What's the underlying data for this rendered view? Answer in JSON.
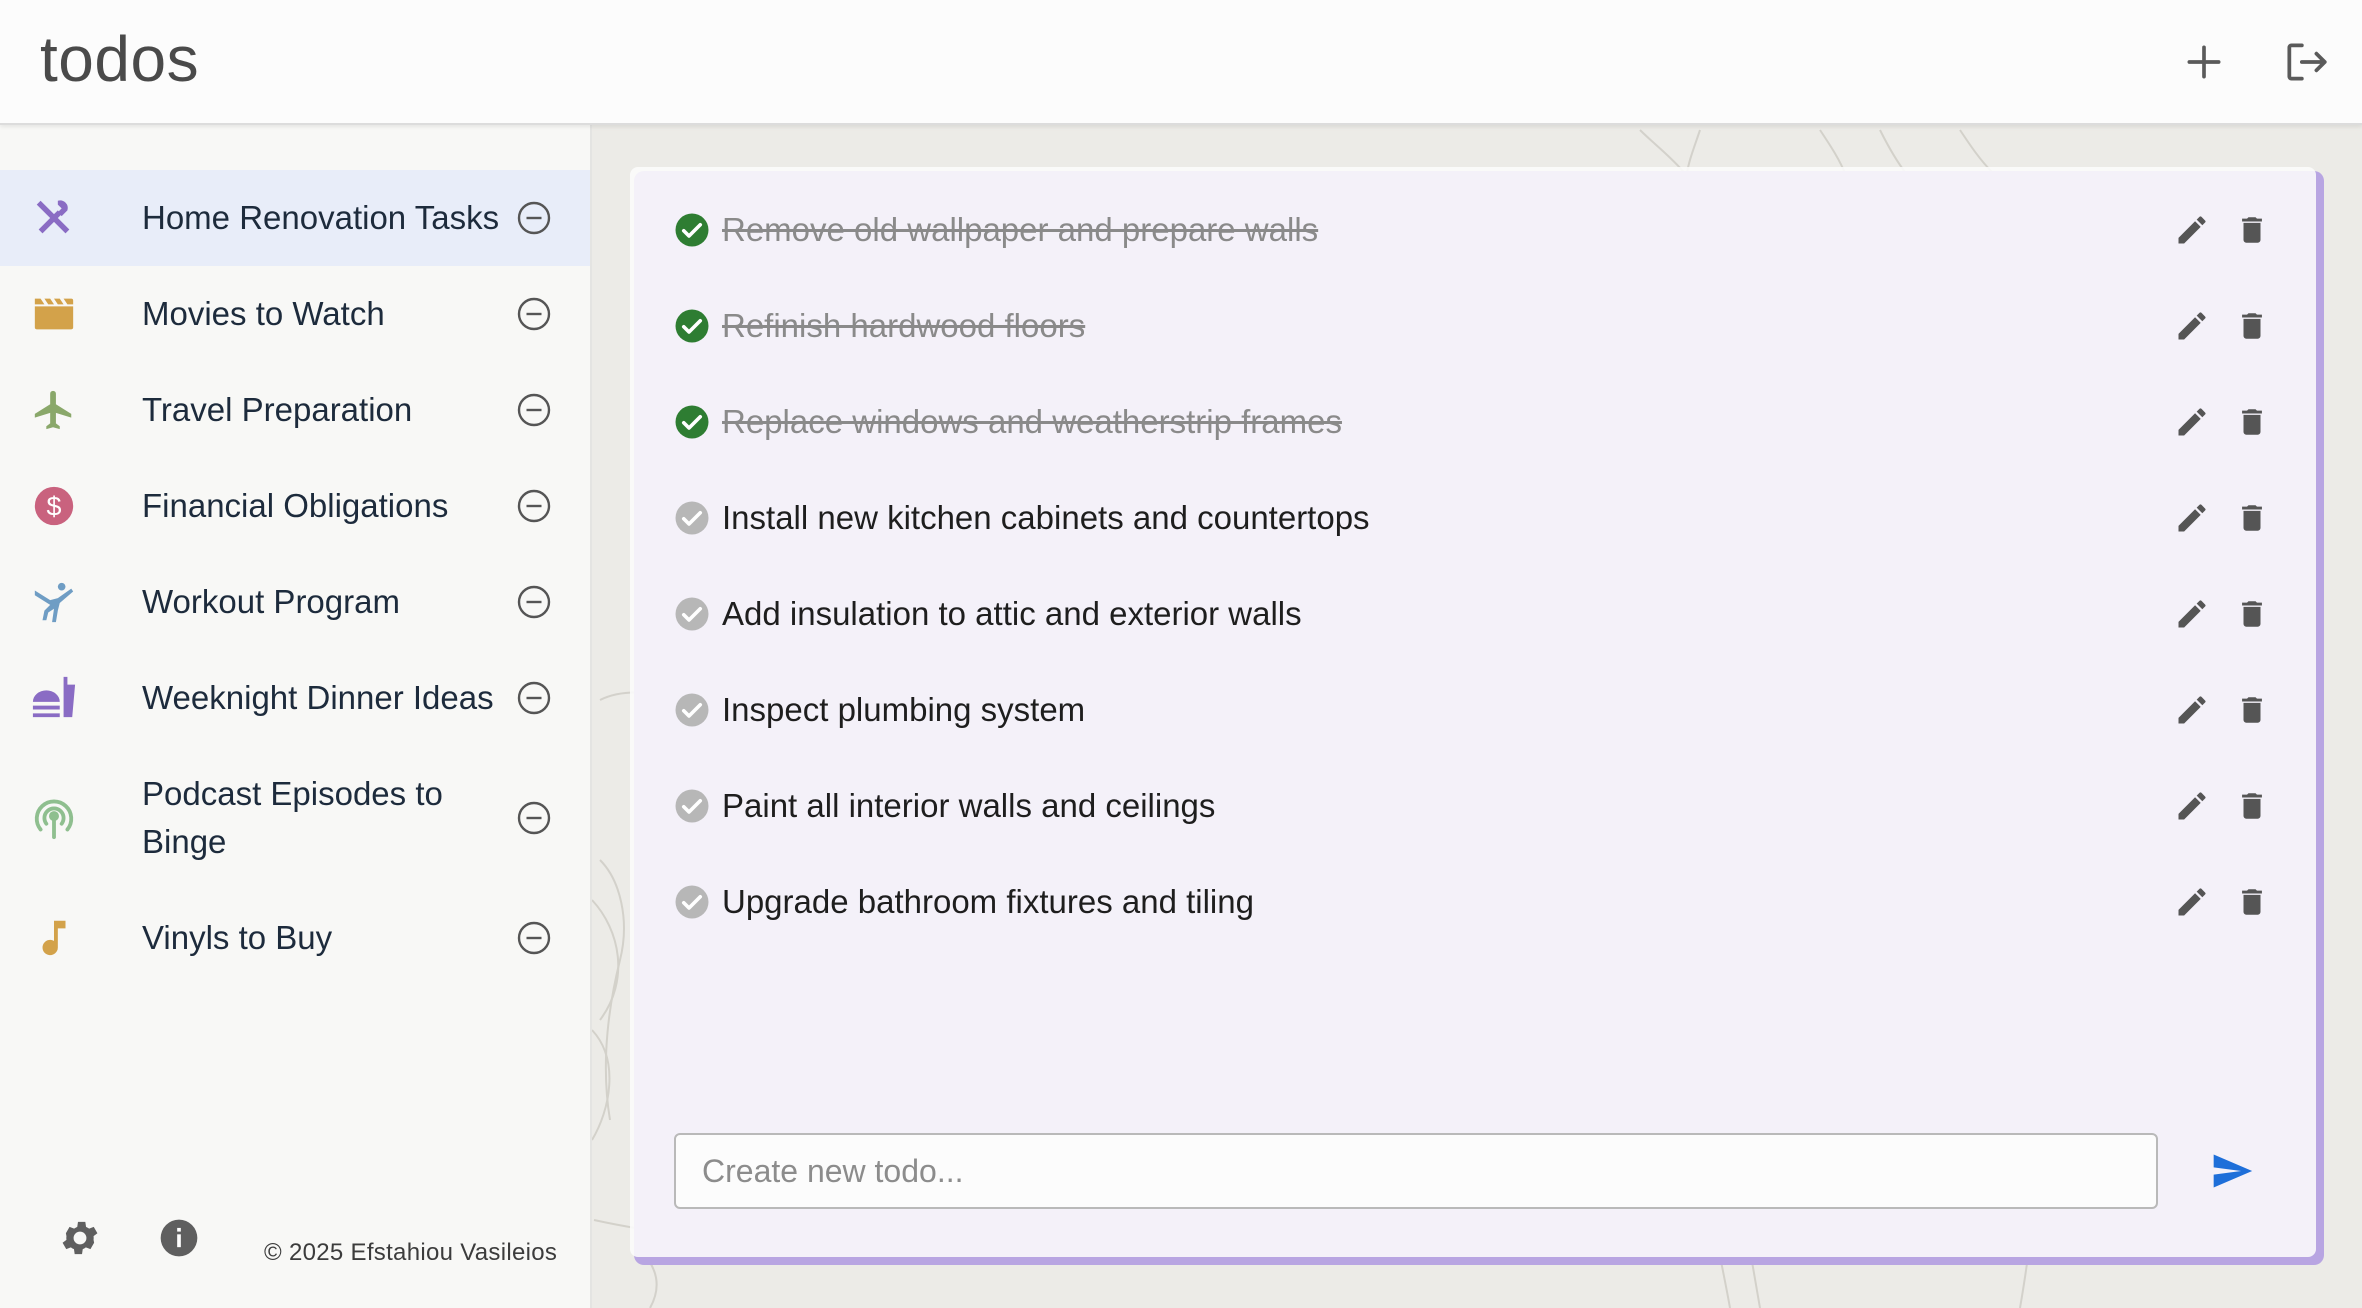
{
  "header": {
    "title": "todos",
    "add_icon": "plus-icon",
    "logout_icon": "logout-icon"
  },
  "sidebar": {
    "items": [
      {
        "label": "Home Renovation Tasks",
        "icon": "tools-icon",
        "color": "#8a6cc4",
        "active": true
      },
      {
        "label": "Movies to Watch",
        "icon": "clapperboard-icon",
        "color": "#d3a24a",
        "active": false
      },
      {
        "label": "Travel Preparation",
        "icon": "airplane-icon",
        "color": "#8aa86a",
        "active": false
      },
      {
        "label": "Financial Obligations",
        "icon": "dollar-icon",
        "color": "#c9627e",
        "active": false
      },
      {
        "label": "Workout Program",
        "icon": "gymnast-icon",
        "color": "#6f9dc4",
        "active": false
      },
      {
        "label": "Weeknight Dinner Ideas",
        "icon": "fastfood-icon",
        "color": "#8a6cc4",
        "active": false
      },
      {
        "label": "Podcast Episodes to Binge",
        "icon": "podcast-icon",
        "color": "#8fbf8f",
        "active": false
      },
      {
        "label": "Vinyls to Buy",
        "icon": "music-note-icon",
        "color": "#d3a24a",
        "active": false
      }
    ],
    "footer": {
      "settings_icon": "gear-icon",
      "info_icon": "info-icon",
      "copyright": "© 2025 Efstahiou Vasileios"
    }
  },
  "todos": [
    {
      "text": "Remove old wallpaper and prepare walls",
      "done": true
    },
    {
      "text": "Refinish hardwood floors",
      "done": true
    },
    {
      "text": "Replace windows and weatherstrip frames",
      "done": true
    },
    {
      "text": "Install new kitchen cabinets and countertops",
      "done": false
    },
    {
      "text": "Add insulation to attic and exterior walls",
      "done": false
    },
    {
      "text": "Inspect plumbing system",
      "done": false
    },
    {
      "text": "Paint all interior walls and ceilings",
      "done": false
    },
    {
      "text": "Upgrade bathroom fixtures and tiling",
      "done": false
    }
  ],
  "new_todo": {
    "placeholder": "Create new todo...",
    "value": ""
  },
  "colors": {
    "accent": "#1e6fd9",
    "done_check": "#2e7d32",
    "pending_check": "#b7b7b7",
    "card_border": "#b8a5e2",
    "active_item": "#e8edf9"
  }
}
